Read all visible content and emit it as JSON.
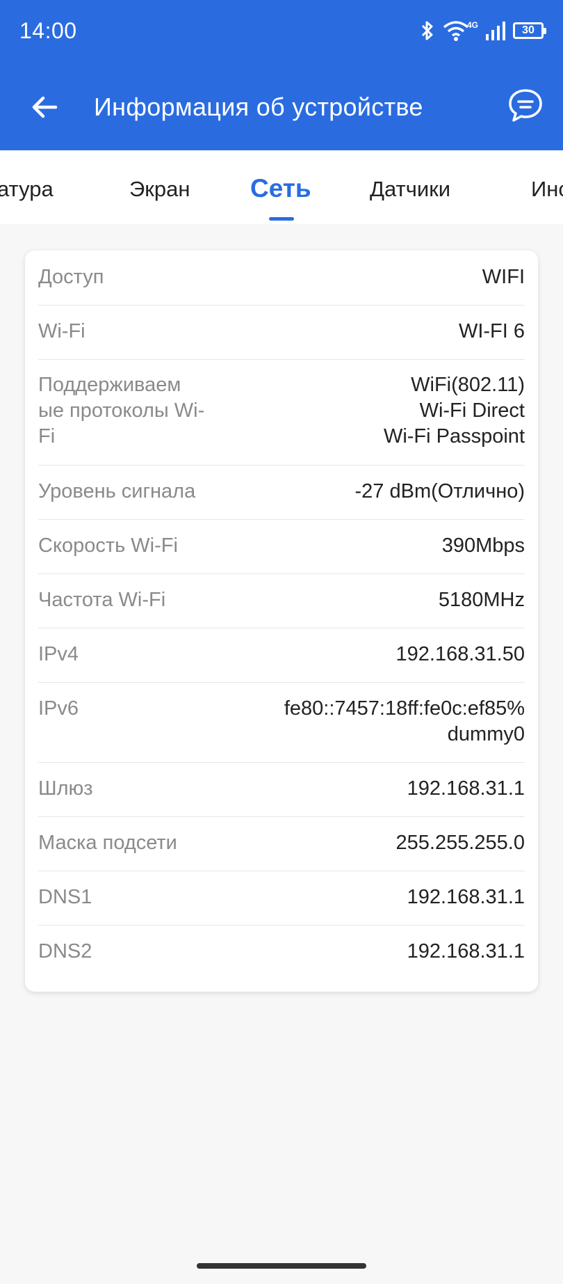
{
  "status_bar": {
    "time": "14:00",
    "battery": "30",
    "network": "4G"
  },
  "app_bar": {
    "title": "Информация об устройстве",
    "back_icon": "arrow-left-icon",
    "chat_icon": "chat-bubble-icon"
  },
  "tabs": [
    {
      "label": "атура"
    },
    {
      "label": "Экран"
    },
    {
      "label": "Сеть"
    },
    {
      "label": "Датчики"
    },
    {
      "label": "Инс"
    }
  ],
  "active_tab": "Сеть",
  "network_info": [
    {
      "label": "Доступ",
      "value": "WIFI"
    },
    {
      "label": "Wi-Fi",
      "value": "WI-FI 6"
    },
    {
      "label": "Поддерживаем ые протоколы Wi-Fi",
      "value_lines": [
        "WiFi(802.11)",
        "Wi-Fi Direct",
        "Wi-Fi Passpoint"
      ]
    },
    {
      "label": "Уровень сигнала",
      "value": "-27 dBm(Отлично)"
    },
    {
      "label": "Скорость Wi-Fi",
      "value": "390Mbps"
    },
    {
      "label": "Частота Wi-Fi",
      "value": "5180MHz"
    },
    {
      "label": "IPv4",
      "value": "192.168.31.50"
    },
    {
      "label": "IPv6",
      "value_lines": [
        "fe80::7457:18ff:fe0c:ef85%",
        "dummy0"
      ]
    },
    {
      "label": "Шлюз",
      "value": "192.168.31.1"
    },
    {
      "label": "Маска подсети",
      "value": "255.255.255.0"
    },
    {
      "label": "DNS1",
      "value": "192.168.31.1"
    },
    {
      "label": "DNS2",
      "value": "192.168.31.1"
    }
  ],
  "colors": {
    "accent": "#2a6ce0",
    "label": "#8a8a8a",
    "value": "#222222"
  }
}
